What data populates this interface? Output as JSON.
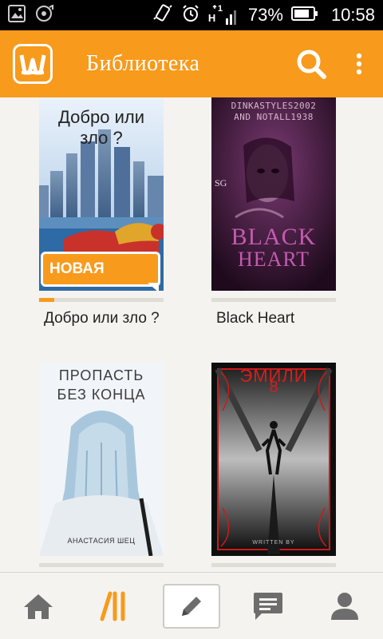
{
  "status_bar": {
    "battery": "73%",
    "time": "10:58",
    "signal_h": "H",
    "signal_digit": "1"
  },
  "app_bar": {
    "title": "Библиотека",
    "logo_letter": "w",
    "icons": [
      "logo-icon",
      "search-icon",
      "more-vert-icon"
    ]
  },
  "library": {
    "books": [
      {
        "title": "Добро или зло ?",
        "cover_text": "Добро или зло ?",
        "badge": "НОВАЯ",
        "progress": 0.12,
        "cover_colors": [
          "#c8dcef",
          "#4b7fb7",
          "#c8322b"
        ]
      },
      {
        "title": "Black Heart",
        "cover_author_line1": "DINKASTYLES2002",
        "cover_author_line2": "AND NOTALL1938",
        "cover_sg": "SG",
        "cover_title_line1": "BLACK",
        "cover_title_line2": "HEART",
        "progress": 0,
        "cover_colors": [
          "#3a1535",
          "#b04a9e"
        ]
      },
      {
        "title": "",
        "cover_title_line1": "ПРОПАСТЬ",
        "cover_title_line2": "БЕЗ КОНЦА",
        "cover_author": "АНАСТАСИЯ ШЕЦ",
        "progress": 0,
        "cover_colors": [
          "#eef3f8",
          "#a9c7dc"
        ]
      },
      {
        "title": "",
        "cover_title": "ЭМИЛИ",
        "cover_numeral": "8",
        "cover_written_by": "WRITTEN BY",
        "progress": 0,
        "cover_colors": [
          "#111111",
          "#cc1a1a"
        ]
      }
    ]
  },
  "bottom_nav": {
    "items": [
      "home-icon",
      "library-icon",
      "write-icon",
      "messages-icon",
      "profile-icon"
    ],
    "active": "library-icon",
    "colors": {
      "active": "#f89a1c",
      "inactive": "#6d6d6d"
    }
  },
  "colors": {
    "brand": "#f89a1c",
    "background": "#f5f3ef"
  }
}
